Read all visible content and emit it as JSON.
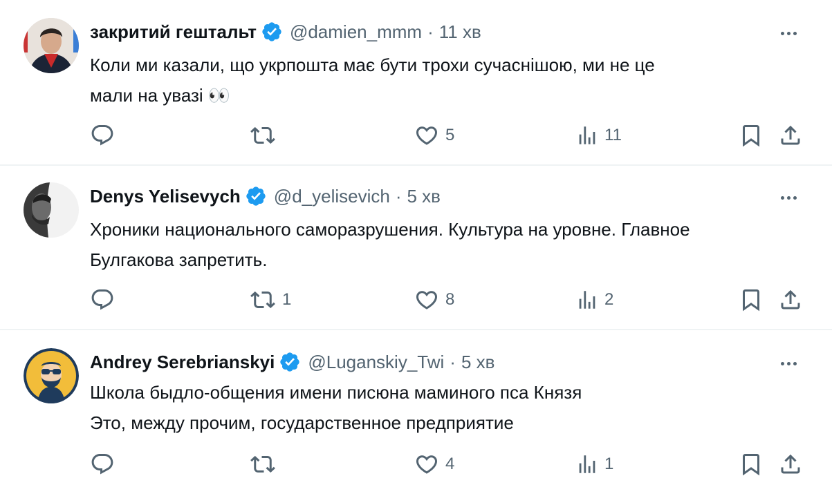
{
  "colors": {
    "verified_badge": "#1d9bf0",
    "secondary_text": "#536471",
    "divider": "#eff3f4"
  },
  "tweets": [
    {
      "display_name": "закритий гештальт",
      "handle": "@damien_mmm",
      "separator": "·",
      "time": "11 хв",
      "text_lines": [
        "Коли ми казали, що укрпошта має бути трохи сучаснішою, ми не це",
        "мали на увазі 👀"
      ],
      "replies": "",
      "retweets": "",
      "likes": "5",
      "views": "11"
    },
    {
      "display_name": "Denys Yelisevych",
      "handle": "@d_yelisevich",
      "separator": "·",
      "time": "5 хв",
      "text_lines": [
        "Хроники национального саморазрушения. Культура на уровне. Главное",
        "Булгакова запретить."
      ],
      "replies": "",
      "retweets": "1",
      "likes": "8",
      "views": "2"
    },
    {
      "display_name": "Andrey Serebrianskyi",
      "handle": "@Luganskiy_Twi",
      "separator": "·",
      "time": "5 хв",
      "text_lines": [
        "Школа быдло-общения имени писюна маминого пса Князя",
        "Это, между прочим, государственное предприятие"
      ],
      "replies": "",
      "retweets": "",
      "likes": "4",
      "views": "1"
    }
  ],
  "icons": {
    "reply": "reply-icon",
    "retweet": "retweet-icon",
    "like": "heart-icon",
    "views": "views-icon",
    "bookmark": "bookmark-icon",
    "share": "share-icon",
    "more": "more-icon",
    "verified": "verified-badge-icon"
  }
}
